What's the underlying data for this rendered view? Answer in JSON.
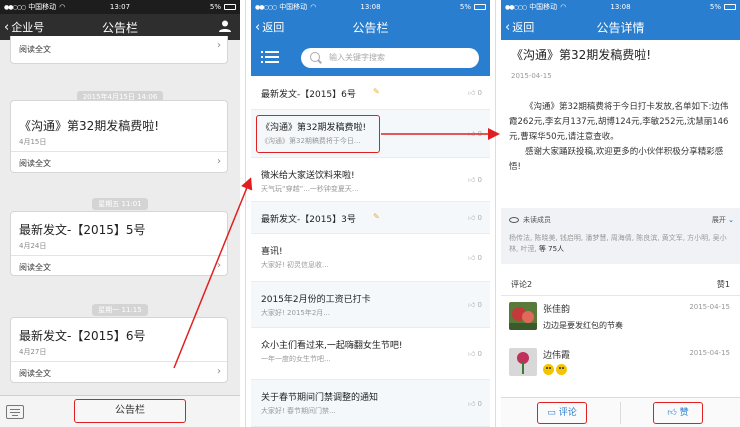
{
  "panel1": {
    "status": {
      "carrier": "中国移动",
      "time": "13:07",
      "battery": "5%"
    },
    "nav": {
      "back": "企业号",
      "title": "公告栏"
    },
    "top_card": {
      "read_label": "阅读全文"
    },
    "cards": [
      {
        "time": "2015年4月15日 14:06",
        "title": "《沟通》第32期发稿费啦!",
        "date": "4月15日",
        "read_label": "阅读全文"
      },
      {
        "time": "星期五 11:01",
        "title": "最新发文-【2015】5号",
        "date": "4月24日",
        "read_label": "阅读全文"
      },
      {
        "time": "星期一 11:15",
        "title": "最新发文-【2015】6号",
        "date": "4月27日",
        "read_label": "阅读全文"
      }
    ],
    "bottom_button": "公告栏"
  },
  "panel2": {
    "status": {
      "carrier": "中国移动",
      "time": "13:08",
      "battery": "5%"
    },
    "nav": {
      "back": "返回",
      "title": "公告栏"
    },
    "search_placeholder": "输入关键字搜索",
    "items": [
      {
        "title": "最新发文-【2015】6号",
        "subtitle": "",
        "likes": "0",
        "pencil": true
      },
      {
        "title": "《沟通》第32期发稿费啦!",
        "subtitle": "《沟通》第32期稿费将于今日...",
        "likes": "0",
        "pencil": false
      },
      {
        "title": "微米给大家送饮料来啦!",
        "subtitle": "天气玩“穿越”...一秒钟变夏天...",
        "likes": "0",
        "pencil": false
      },
      {
        "title": "最新发文-【2015】3号",
        "subtitle": "",
        "likes": "0",
        "pencil": true
      },
      {
        "title": "喜讯!",
        "subtitle": "大家好! 初灵信息收...",
        "likes": "0",
        "pencil": false
      },
      {
        "title": "2015年2月份的工资已打卡",
        "subtitle": "大家好! 2015年2月...",
        "likes": "0",
        "pencil": false
      },
      {
        "title": "众小主们看过来,一起嗨翻女生节吧!",
        "subtitle": "一年一度的女生节吧...",
        "likes": "0",
        "pencil": false
      },
      {
        "title": "关于春节期间门禁调整的通知",
        "subtitle": "大家好! 春节期间门禁...",
        "likes": "0",
        "pencil": false
      }
    ]
  },
  "panel3": {
    "status": {
      "carrier": "中国移动",
      "time": "13:08",
      "battery": "5%"
    },
    "nav": {
      "back": "返回",
      "title": "公告详情"
    },
    "title": "《沟通》第32期发稿费啦!",
    "date": "2015-04-15",
    "body_p1": "《沟通》第32期稿费将于今日打卡发放,名单如下:边伟霞262元,李玄月137元,胡博124元,李敏252元,沈慧丽146元,曹琛华50元,请注意查收。",
    "body_p2": "感谢大家踊跃投稿,欢迎更多的小伙伴积极分享精彩感悟!",
    "readers": {
      "header": "未读成员",
      "expand": "展开",
      "names": "杨传法, 陈晓美, 钱启明, 潘梦慧, 周海倩, 陈良滨, 黄文军, 方小明, 吴小林, 叶滢,",
      "count_label": "等 75人"
    },
    "comments_header": {
      "left": "评论2",
      "right": "赞1"
    },
    "comments": [
      {
        "name": "张佳韵",
        "time": "2015-04-15",
        "text": "边边是要发红包的节奏"
      },
      {
        "name": "边伟霞",
        "time": "2015-04-15",
        "text": ""
      }
    ],
    "footer": {
      "comment": "评论",
      "like": "赞"
    }
  },
  "colors": {
    "accent_blue": "#2a7ed0",
    "highlight_red": "#e02020",
    "nav_dark": "#2e2e2e"
  },
  "icons": [
    "signal-dots-icon",
    "wifi-icon",
    "battery-icon",
    "user-icon",
    "chevron-right-icon",
    "keyboard-icon",
    "menu-list-icon",
    "search-icon",
    "pencil-icon",
    "thumbs-up-icon",
    "eye-icon",
    "chevron-down-icon",
    "comment-icon",
    "emoji-icon"
  ]
}
